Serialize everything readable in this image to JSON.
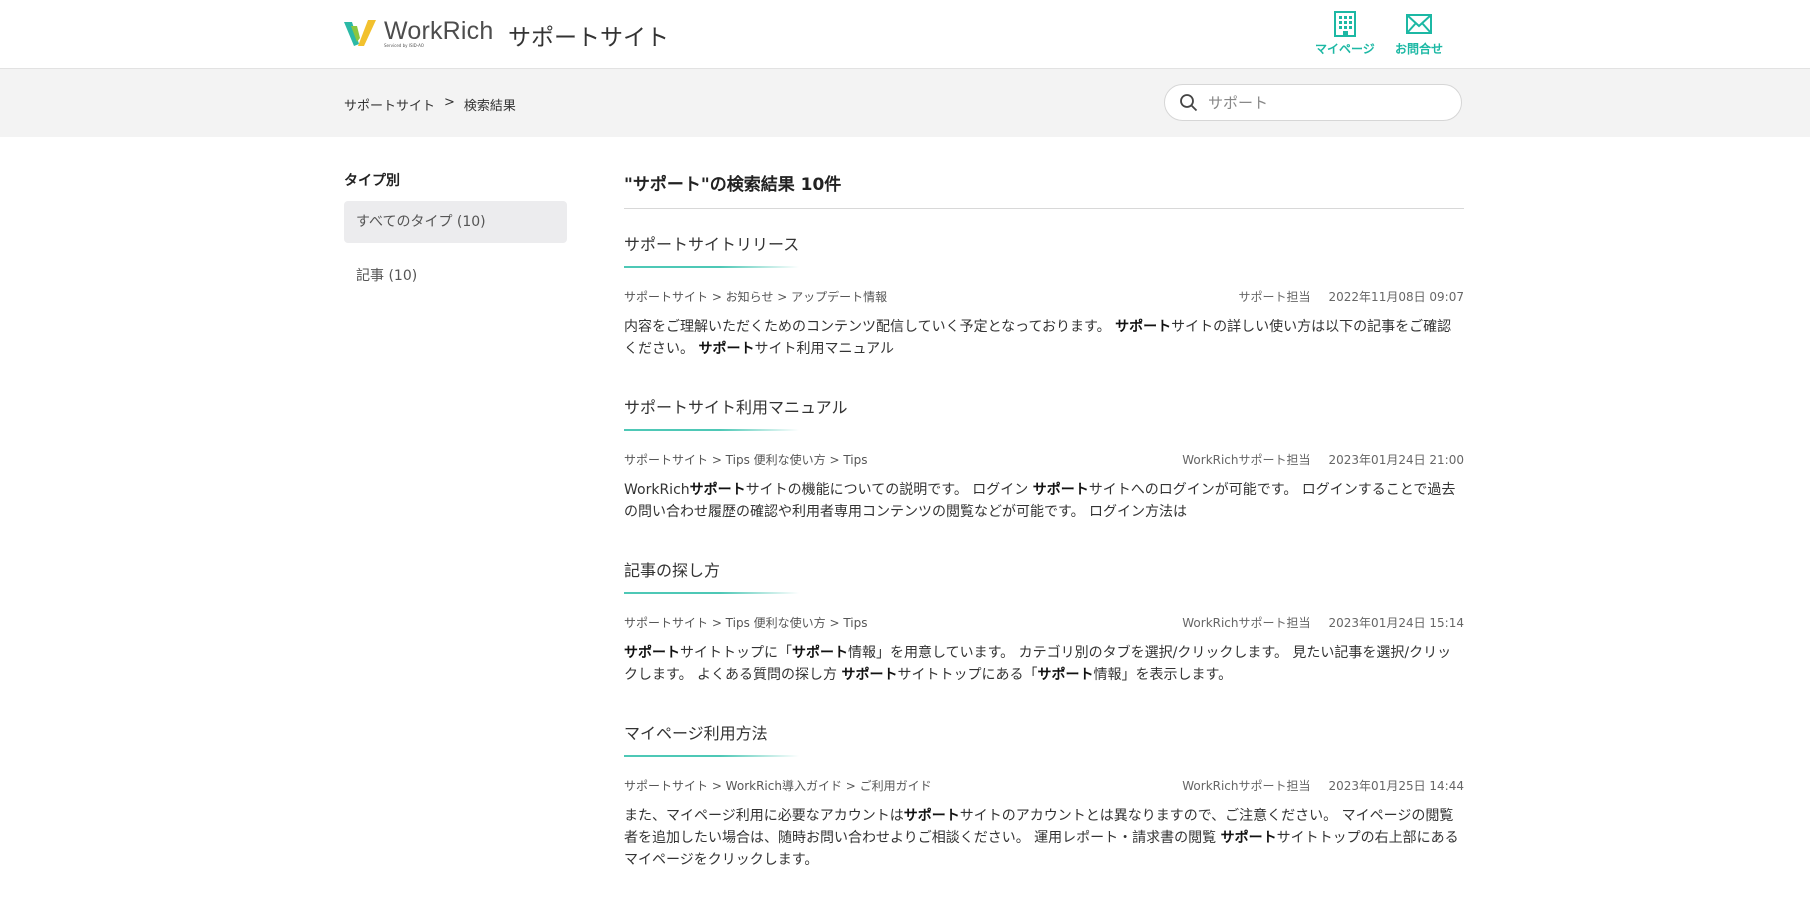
{
  "header": {
    "logo_text": "WorkRich",
    "logo_subtext": "Serviced by ISID-AO",
    "site_title": "サポートサイト",
    "links": [
      {
        "label": "マイページ",
        "icon": "building-icon"
      },
      {
        "label": "お問合せ",
        "icon": "mail-icon"
      }
    ]
  },
  "breadcrumb": {
    "items": [
      "サポートサイト",
      "検索結果"
    ],
    "separator": ">"
  },
  "search": {
    "value": "",
    "placeholder": "サポート"
  },
  "sidebar": {
    "heading": "タイプ別",
    "items": [
      {
        "label": "すべてのタイプ (10)",
        "active": true
      },
      {
        "label": "記事 (10)",
        "active": false
      }
    ]
  },
  "main": {
    "results_title": "\"サポート\"の検索結果 10件",
    "results": [
      {
        "title": "サポートサイトリリース",
        "path": "サポートサイト > お知らせ > アップデート情報",
        "author": "サポート担当",
        "date": "2022年11月08日 09:07",
        "snippet": [
          {
            "t": "内容をご理解いただくためのコンテンツ配信していく予定となっております。 ",
            "b": false
          },
          {
            "t": "サポート",
            "b": true
          },
          {
            "t": "サイトの詳しい使い方は以下の記事をご確認ください。 ",
            "b": false
          },
          {
            "t": "サポート",
            "b": true
          },
          {
            "t": "サイト利用マニュアル",
            "b": false
          }
        ]
      },
      {
        "title": "サポートサイト利用マニュアル",
        "path": "サポートサイト > Tips 便利な使い方 > Tips",
        "author": "WorkRichサポート担当",
        "date": "2023年01月24日 21:00",
        "snippet": [
          {
            "t": "WorkRich",
            "b": false
          },
          {
            "t": "サポート",
            "b": true
          },
          {
            "t": "サイトの機能についての説明です。 ログイン ",
            "b": false
          },
          {
            "t": "サポート",
            "b": true
          },
          {
            "t": "サイトへのログインが可能です。 ログインすることで過去の問い合わせ履歴の確認や利用者専用コンテンツの閲覧などが可能です。 ログイン方法は",
            "b": false
          }
        ]
      },
      {
        "title": "記事の探し方",
        "path": "サポートサイト > Tips 便利な使い方 > Tips",
        "author": "WorkRichサポート担当",
        "date": "2023年01月24日 15:14",
        "snippet": [
          {
            "t": "サポート",
            "b": true
          },
          {
            "t": "サイトトップに「",
            "b": false
          },
          {
            "t": "サポート",
            "b": true
          },
          {
            "t": "情報」を用意しています。 カテゴリ別のタブを選択/クリックします。 見たい記事を選択/クリックします。 よくある質問の探し方 ",
            "b": false
          },
          {
            "t": "サポート",
            "b": true
          },
          {
            "t": "サイトトップにある「",
            "b": false
          },
          {
            "t": "サポート",
            "b": true
          },
          {
            "t": "情報」を表示します。",
            "b": false
          }
        ]
      },
      {
        "title": "マイページ利用方法",
        "path": "サポートサイト > WorkRich導入ガイド > ご利用ガイド",
        "author": "WorkRichサポート担当",
        "date": "2023年01月25日 14:44",
        "snippet": [
          {
            "t": "また、マイページ利用に必要なアカウントは",
            "b": false
          },
          {
            "t": "サポート",
            "b": true
          },
          {
            "t": "サイトのアカウントとは異なりますので、ご注意ください。 マイページの閲覧者を追加したい場合は、随時お問い合わせよりご相談ください。 運用レポート・請求書の閲覧 ",
            "b": false
          },
          {
            "t": "サポート",
            "b": true
          },
          {
            "t": "サイトトップの右上部にあるマイページをクリックします。",
            "b": false
          }
        ]
      }
    ]
  },
  "colors": {
    "accent": "#1cb8a4",
    "crumb_bg": "#f3f3f3",
    "active_bg": "#ececee"
  }
}
